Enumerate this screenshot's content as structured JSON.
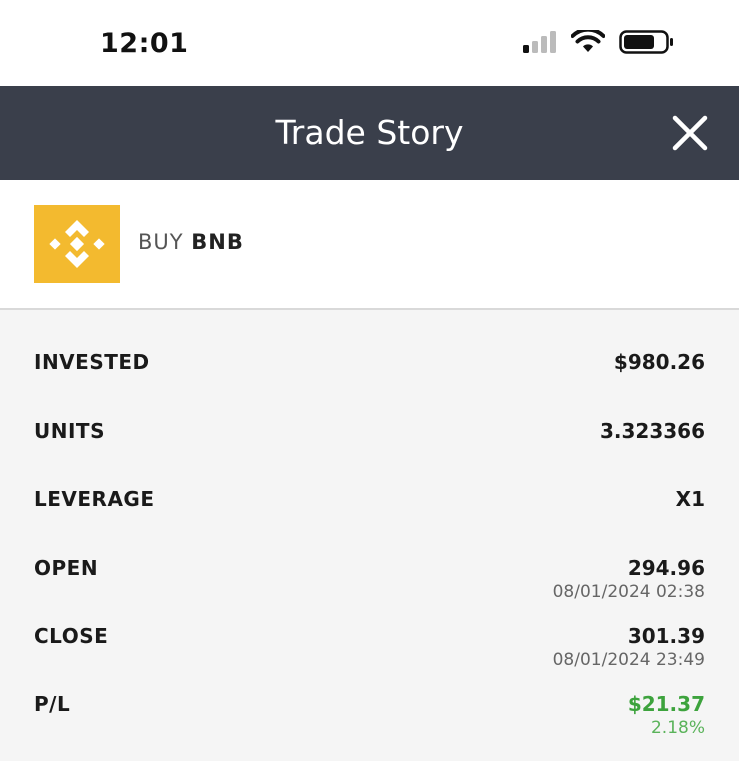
{
  "status_bar": {
    "time": "12:01"
  },
  "header": {
    "title": "Trade Story"
  },
  "asset": {
    "action": "BUY",
    "symbol": "BNB",
    "logo_color": "#f3ba2f"
  },
  "details": {
    "invested": {
      "label": "INVESTED",
      "value": "$980.26"
    },
    "units": {
      "label": "UNITS",
      "value": "3.323366"
    },
    "leverage": {
      "label": "LEVERAGE",
      "value": "X1"
    },
    "open": {
      "label": "OPEN",
      "value": "294.96",
      "date": "08/01/2024 02:38"
    },
    "close": {
      "label": "CLOSE",
      "value": "301.39",
      "date": "08/01/2024 23:49"
    },
    "pl": {
      "label": "P/L",
      "value": "$21.37",
      "percent": "2.18%",
      "color": "#3da33d"
    }
  }
}
